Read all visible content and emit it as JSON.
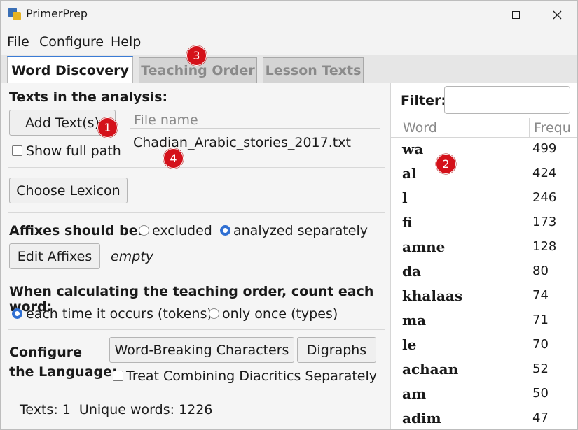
{
  "window": {
    "title": "PrimerPrep"
  },
  "menu": {
    "items": [
      "File",
      "Configure",
      "Help"
    ]
  },
  "tabs": [
    {
      "label": "Word Discovery",
      "active": true
    },
    {
      "label": "Teaching Order",
      "active": false
    },
    {
      "label": "Lesson Texts",
      "active": false
    }
  ],
  "texts_section": {
    "title": "Texts in the analysis:",
    "add_button": "Add Text(s)",
    "show_full_path_label": "Show full path",
    "show_full_path_checked": false,
    "file_column_header": "File name",
    "files": [
      "Chadian_Arabic_stories_2017.txt"
    ]
  },
  "lexicon": {
    "choose_button": "Choose Lexicon"
  },
  "affixes": {
    "label": "Affixes should be:",
    "options": [
      "excluded",
      "analyzed separately"
    ],
    "selected": "analyzed separately",
    "edit_button": "Edit Affixes",
    "status": "empty"
  },
  "counting": {
    "label": "When calculating the teaching order, count each word:",
    "options": [
      "each time it occurs (tokens)",
      "only once (types)"
    ],
    "selected": "each time it occurs (tokens)"
  },
  "language": {
    "label_line1": "Configure",
    "label_line2": "the Language:",
    "word_breaking_button": "Word-Breaking Characters",
    "digraphs_button": "Digraphs",
    "combining_label": "Treat Combining Diacritics Separately",
    "combining_checked": false
  },
  "status_bar": {
    "text": "Texts: 1  Unique words: 1226"
  },
  "word_list": {
    "filter_label": "Filter:",
    "filter_value": "",
    "word_header": "Word",
    "freq_header": "Frequ",
    "rows": [
      {
        "word": "wa",
        "freq": "499"
      },
      {
        "word": "al",
        "freq": "424"
      },
      {
        "word": "l",
        "freq": "246"
      },
      {
        "word": "fi",
        "freq": "173"
      },
      {
        "word": "amne",
        "freq": "128"
      },
      {
        "word": "da",
        "freq": "80"
      },
      {
        "word": "khalaas",
        "freq": "74"
      },
      {
        "word": "ma",
        "freq": "71"
      },
      {
        "word": "le",
        "freq": "70"
      },
      {
        "word": "achaan",
        "freq": "52"
      },
      {
        "word": "am",
        "freq": "50"
      },
      {
        "word": "adim",
        "freq": "47"
      }
    ]
  },
  "annotations": [
    "1",
    "2",
    "3",
    "4"
  ],
  "colors": {
    "accent": "#2f6fd2",
    "badge": "#d4111a",
    "panel_bg": "#f5f5f5"
  }
}
